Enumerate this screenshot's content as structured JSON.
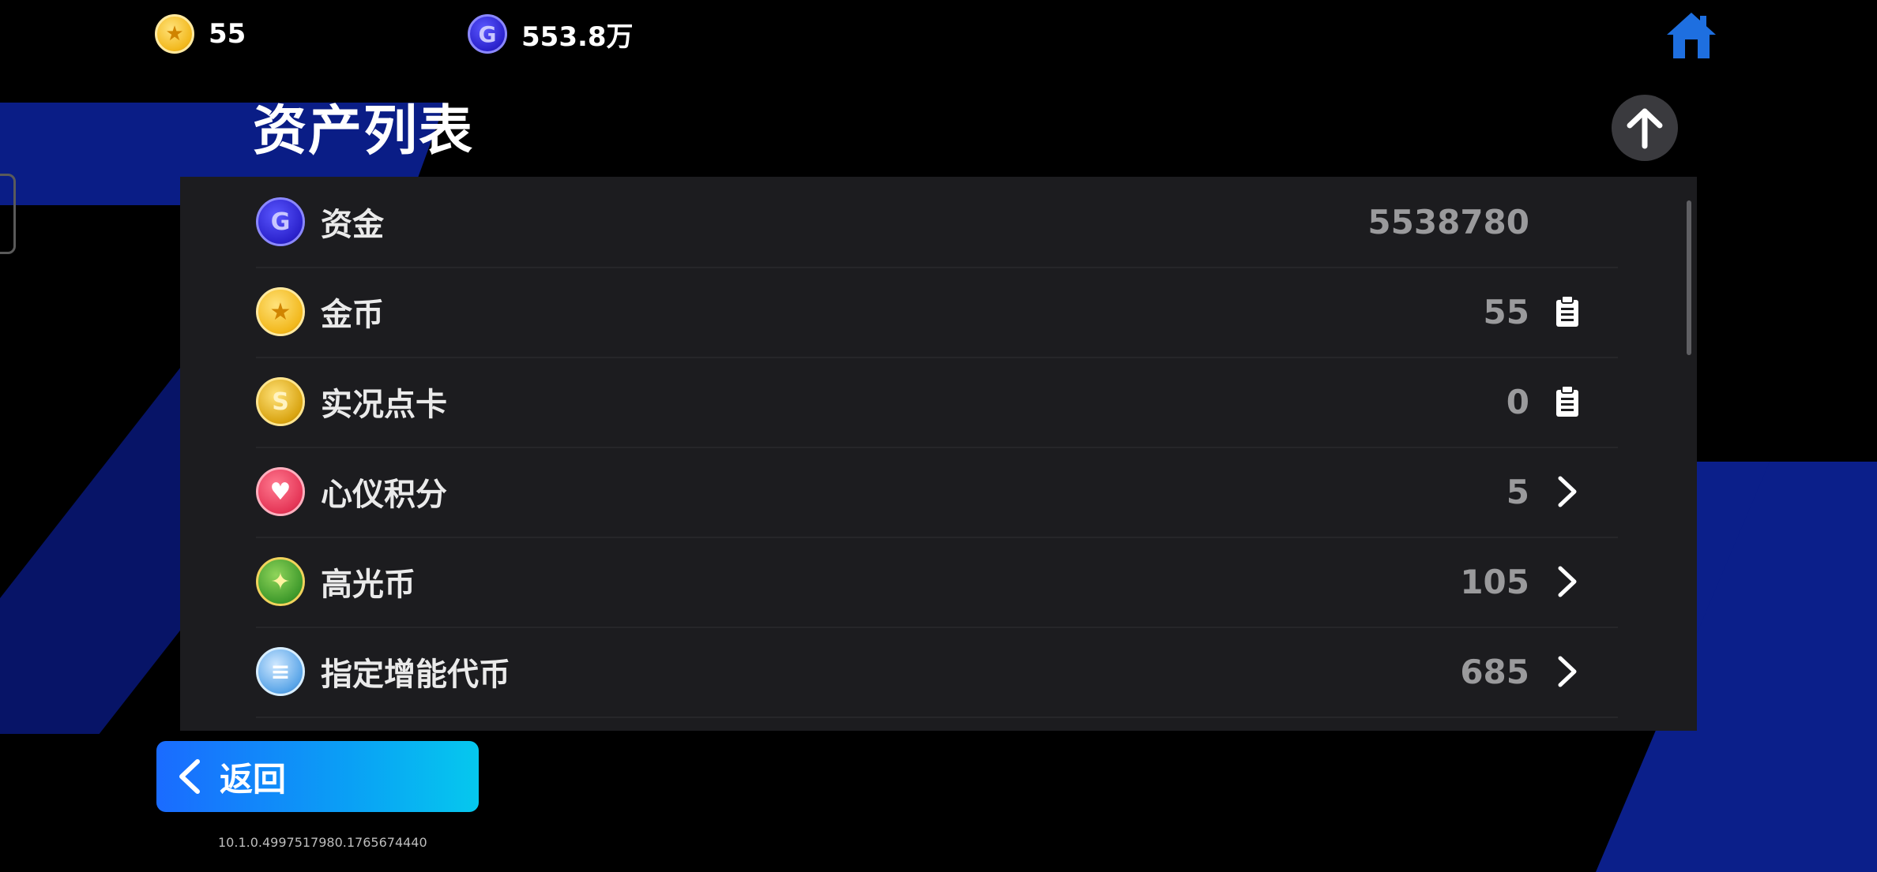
{
  "topbar": {
    "gold_coin_amount": "55",
    "funds_amount": "553.8万"
  },
  "page": {
    "title": "资产列表"
  },
  "assets": [
    {
      "name": "资金",
      "value": "5538780",
      "icon": "g-coin-icon",
      "action": "none"
    },
    {
      "name": "金币",
      "value": "55",
      "icon": "star-coin-icon",
      "action": "clipboard-icon"
    },
    {
      "name": "实况点卡",
      "value": "0",
      "icon": "s-coin-icon",
      "action": "clipboard-icon"
    },
    {
      "name": "心仪积分",
      "value": "5",
      "icon": "heart-coin-icon",
      "action": "chevron-right-icon"
    },
    {
      "name": "高光币",
      "value": "105",
      "icon": "highlight-coin-icon",
      "action": "chevron-right-icon"
    },
    {
      "name": "指定增能代币",
      "value": "685",
      "icon": "boost-token-icon",
      "action": "chevron-right-icon"
    }
  ],
  "back_button": {
    "label": "返回"
  },
  "version": "10.1.0.4997517980.1765674440",
  "colors": {
    "background": "#000000",
    "panel": "#1c1c1f",
    "accent_blue": "#1a6bff",
    "cyan": "#05c8ee",
    "home_icon": "#1e6fe0"
  }
}
